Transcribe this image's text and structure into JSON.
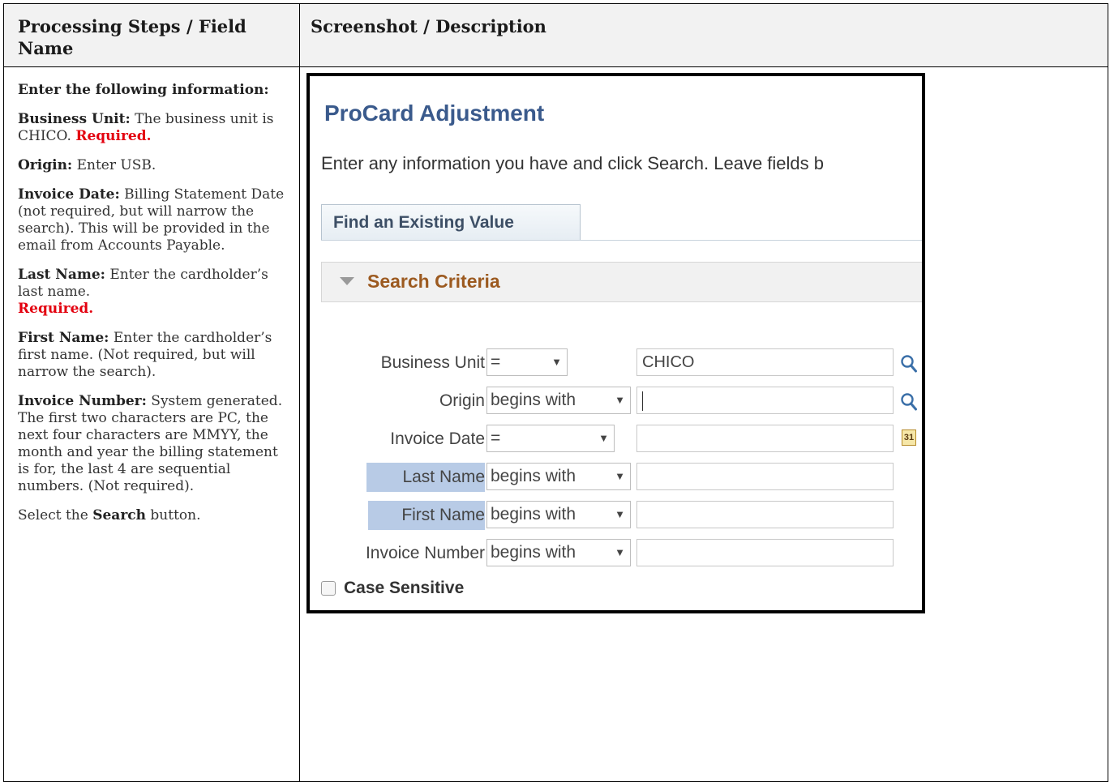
{
  "table": {
    "col1_header": "Processing Steps / Field Name",
    "col2_header": "Screenshot / Description"
  },
  "steps": {
    "intro": "Enter the following information:",
    "business_unit_label": "Business Unit:",
    "business_unit_text": " The business unit is CHICO. ",
    "required": "Required.",
    "origin_label": "Origin:",
    "origin_text": " Enter USB.",
    "invoice_date_label": "Invoice Date:",
    "invoice_date_text": "  Billing Statement Date (not required, but will narrow the search). This will be provided in the email from Accounts Payable.",
    "last_name_label": "Last Name:",
    "last_name_text": " Enter the cardholder’s last name. ",
    "first_name_label": "First Name:",
    "first_name_text": "  Enter the cardholder’s first name. (Not required, but will narrow the search).",
    "invoice_number_label": "Invoice Number:",
    "invoice_number_text": " System generated. The first two characters are PC, the next four characters are MMYY, the month and year the billing statement is for, the last 4 are sequential numbers. (Not required).",
    "select_prefix": "Select the ",
    "search_word": "Search",
    "select_suffix": " button."
  },
  "screenshot": {
    "title": "ProCard Adjustment",
    "instruction": "Enter any information you have and click Search. Leave fields b",
    "tab": "Find an Existing Value",
    "section": "Search Criteria",
    "fields": [
      {
        "label": "Business Unit",
        "operator": "=",
        "value": "CHICO",
        "icon": "magnifier-lookup-icon"
      },
      {
        "label": "Origin",
        "operator": "begins with",
        "value": "",
        "icon": "magnifier-lookup-icon"
      },
      {
        "label": "Invoice Date",
        "operator": "=",
        "value": "",
        "icon": "calendar-icon",
        "icon_text": "31"
      },
      {
        "label": "Last Name",
        "operator": "begins with",
        "value": ""
      },
      {
        "label": "First Name",
        "operator": "begins with",
        "value": ""
      },
      {
        "label": "Invoice Number",
        "operator": "begins with",
        "value": ""
      }
    ],
    "case_sensitive": "Case Sensitive"
  },
  "colors": {
    "required_red": "#e3000f",
    "title_blue": "#3a5a8c",
    "section_brown": "#9c5a20",
    "highlight_blue": "#b8cbe6"
  }
}
